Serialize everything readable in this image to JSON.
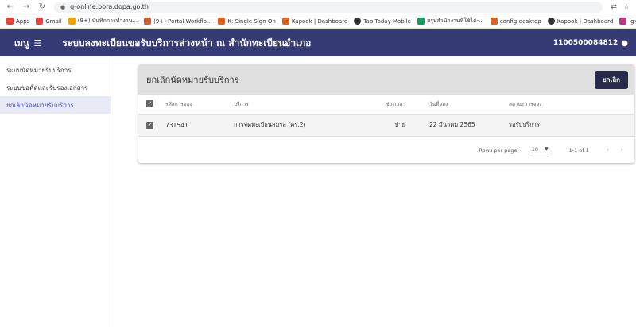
{
  "browser": {
    "url": "q-online.bora.dopa.go.th",
    "bookmarks": [
      {
        "label": "Apps",
        "color": "#e94235"
      },
      {
        "label": "Gmail",
        "color": "#ea4335"
      },
      {
        "label": "(9+) บันทึกการทำงาน...",
        "color": "#f4a300"
      },
      {
        "label": "(9+) Portal Workflo...",
        "color": "#cf5c32"
      },
      {
        "label": "K: Single Sign On",
        "color": "#e06020"
      },
      {
        "label": "Kapook | Dashboard",
        "color": "#e06020"
      },
      {
        "label": "Tap Today Mobile",
        "color": "#333333"
      },
      {
        "label": "สรุปสำนักงานที่ใช้ได้-...",
        "color": "#0f9d58"
      },
      {
        "label": "config-desktop",
        "color": "#e06020"
      },
      {
        "label": "Kapook | Dashboard",
        "color": "#333333"
      },
      {
        "label": "ig",
        "color": "#c13584"
      }
    ],
    "more": "»"
  },
  "header": {
    "menu_label": "เมนู",
    "title": "ระบบลงทะเบียนขอรับบริการล่วงหน้า ณ สำนักทะเบียนอำเภอ",
    "user_id": "1100500084812"
  },
  "sidebar": {
    "items": [
      {
        "label": "ระบบนัดหมายรับบริการ"
      },
      {
        "label": "ระบบขอคัดและรับรองเอกสาร"
      },
      {
        "label": "ยกเลิกนัดหมายรับบริการ"
      }
    ]
  },
  "card": {
    "title": "ยกเลิกนัดหมายรับบริการ",
    "cancel_label": "ยกเลิก",
    "columns": {
      "code": "รหัสการจอง",
      "service": "บริการ",
      "time": "ช่วงเวลา",
      "date": "วันที่จอง",
      "status": "สถานะการจอง"
    },
    "rows": [
      {
        "code": "731541",
        "service": "การจดทะเบียนสมรส (คร.2)",
        "time": "บ่าย",
        "date": "22 มีนาคม 2565",
        "status": "รอรับบริการ"
      }
    ],
    "footer": {
      "rows_per_page_label": "Rows per page:",
      "rows_per_page": "10",
      "range": "1-1 of 1"
    }
  }
}
